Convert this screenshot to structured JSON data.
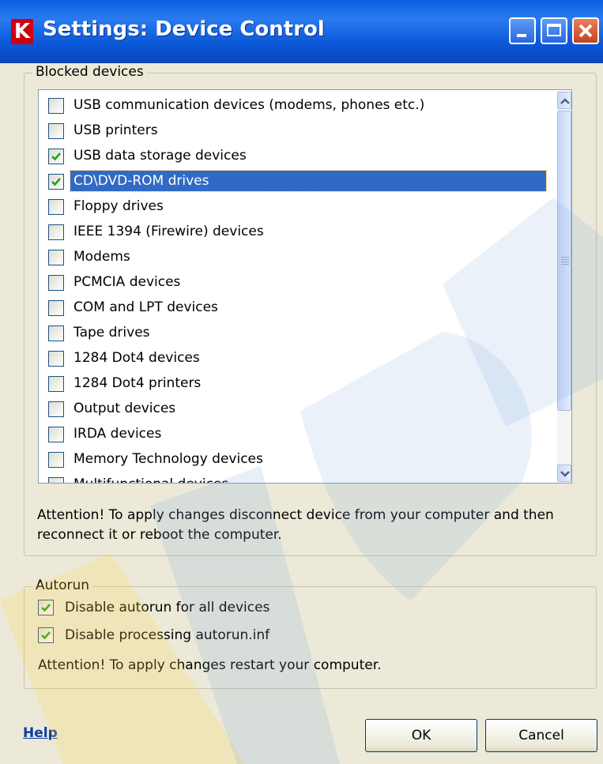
{
  "window": {
    "title": "Settings: Device Control",
    "logo_letter": "K"
  },
  "blocked_devices": {
    "legend": "Blocked devices",
    "items": [
      {
        "label": "USB communication devices (modems, phones etc.)",
        "checked": false
      },
      {
        "label": "USB printers",
        "checked": false
      },
      {
        "label": "USB data storage devices",
        "checked": true
      },
      {
        "label": "CD\\DVD-ROM drives",
        "checked": true,
        "selected": true
      },
      {
        "label": "Floppy drives",
        "checked": false
      },
      {
        "label": "IEEE 1394 (Firewire) devices",
        "checked": false
      },
      {
        "label": "Modems",
        "checked": false
      },
      {
        "label": "PCMCIA devices",
        "checked": false
      },
      {
        "label": "COM and LPT devices",
        "checked": false
      },
      {
        "label": "Tape drives",
        "checked": false
      },
      {
        "label": "1284 Dot4 devices",
        "checked": false
      },
      {
        "label": "1284 Dot4 printers",
        "checked": false
      },
      {
        "label": "Output devices",
        "checked": false
      },
      {
        "label": "IRDA devices",
        "checked": false
      },
      {
        "label": "Memory Technology devices",
        "checked": false
      },
      {
        "label": "Multifunctional devices",
        "checked": false
      }
    ],
    "note": "Attention! To apply changes disconnect device from your computer and then reconnect it or reboot the computer."
  },
  "autorun": {
    "legend": "Autorun",
    "disable_all_label": "Disable autorun for all devices",
    "disable_all_checked": true,
    "disable_inf_label": "Disable processing autorun.inf",
    "disable_inf_checked": true,
    "note": "Attention! To apply changes restart your computer."
  },
  "footer": {
    "help_label": "Help",
    "ok_label": "OK",
    "cancel_label": "Cancel"
  },
  "colors": {
    "selection": "#316ac5",
    "titlebar": "#0a5ee0",
    "check": "#21a121"
  }
}
